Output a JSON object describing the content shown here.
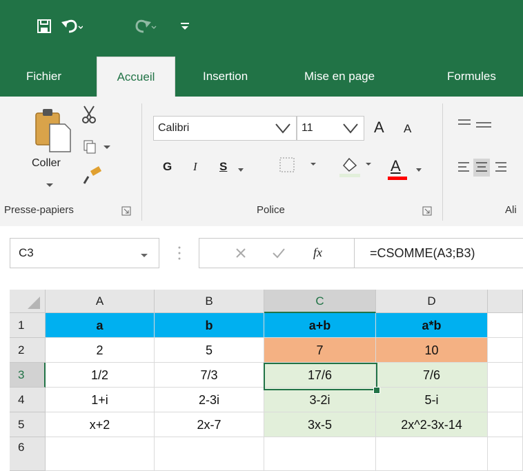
{
  "quick_access": {
    "save_icon": "save-icon",
    "undo_icon": "undo-icon",
    "redo_icon": "redo-icon",
    "customize_icon": "customize-qat-icon"
  },
  "tabs": [
    {
      "label": "Fichier"
    },
    {
      "label": "Accueil"
    },
    {
      "label": "Insertion"
    },
    {
      "label": "Mise en page"
    },
    {
      "label": "Formules"
    }
  ],
  "ribbon": {
    "clipboard": {
      "paste_label": "Coller",
      "group_label": "Presse-papiers"
    },
    "font": {
      "font_name": "Calibri",
      "font_size": "11",
      "bold": "G",
      "italic": "I",
      "underline": "S",
      "grow": "A",
      "shrink": "A",
      "color_letter": "A",
      "group_label": "Police"
    },
    "alignment": {
      "group_label": "Ali"
    }
  },
  "formula_bar": {
    "name_box": "C3",
    "fx_label": "fx",
    "formula": "=CSOMME(A3;B3)"
  },
  "sheet": {
    "columns": [
      "A",
      "B",
      "C",
      "D"
    ],
    "rows": [
      {
        "num": "1",
        "cells": [
          "a",
          "b",
          "a+b",
          "a*b"
        ]
      },
      {
        "num": "2",
        "cells": [
          "2",
          "5",
          "7",
          "10"
        ]
      },
      {
        "num": "3",
        "cells": [
          "1/2",
          "7/3",
          "17/6",
          "7/6"
        ]
      },
      {
        "num": "4",
        "cells": [
          "1+i",
          "2-3i",
          "3-2i",
          "5-i"
        ]
      },
      {
        "num": "5",
        "cells": [
          "x+2",
          "2x-7",
          "3x-5",
          "2x^2-3x-14"
        ]
      },
      {
        "num": "6",
        "cells": [
          "",
          "",
          "",
          ""
        ]
      }
    ],
    "active_cell": "C3"
  },
  "colors": {
    "accent": "#217346",
    "header_fill": "#00b0f0",
    "row2_fill": "#f4b183",
    "result_fill": "#e2efda"
  }
}
